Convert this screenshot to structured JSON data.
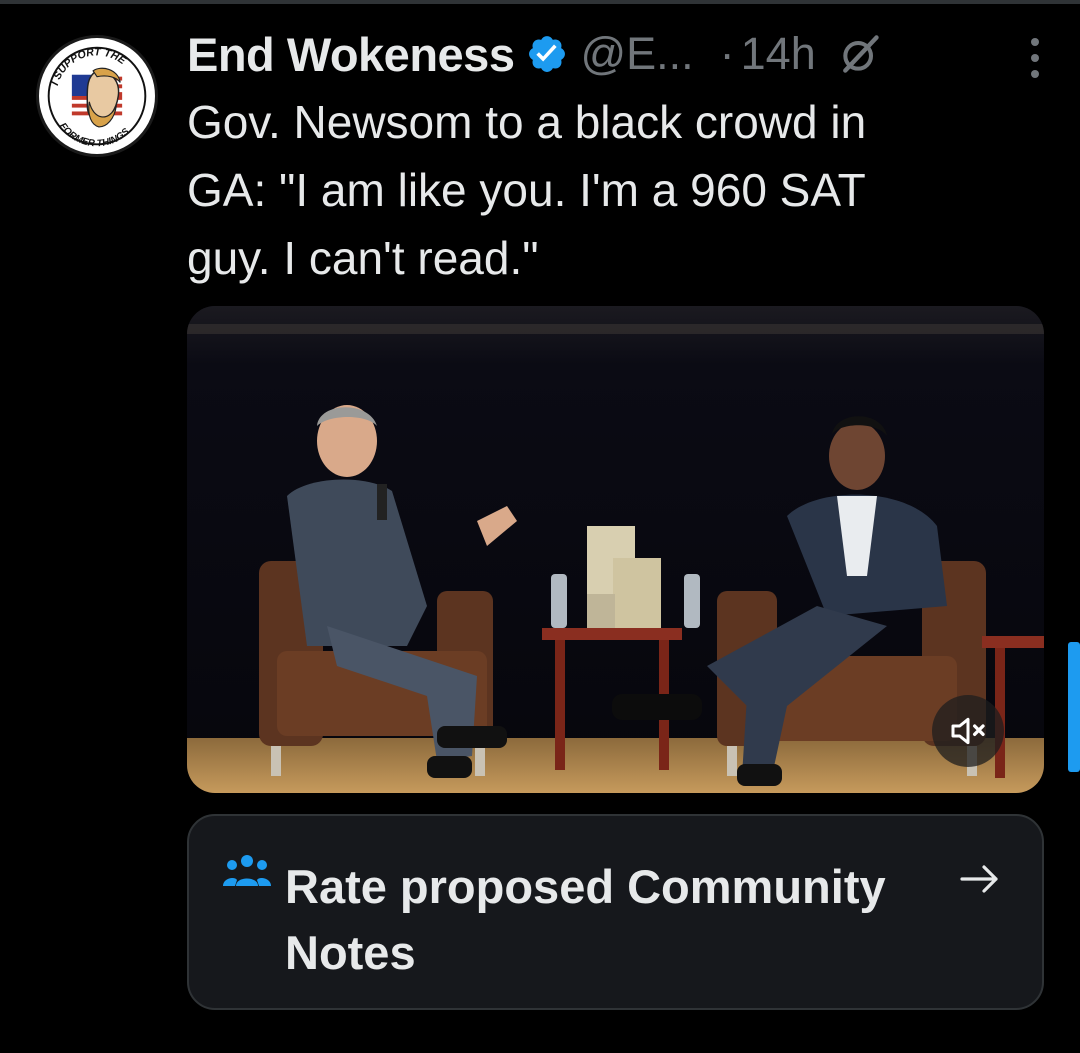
{
  "author": {
    "name": "End Wokeness",
    "handle": "@E...",
    "separator": "·",
    "time": "14h",
    "verified": true,
    "avatar_icon": "i-support-the-former-things-badge",
    "avatar_text_top": "I SUPPORT THE",
    "avatar_text_bottom": "FORMER THINGS"
  },
  "tweet": {
    "lines": [
      "Gov. Newsom to a black crowd in",
      "GA: \"I am like you. I'm a 960 SAT",
      "guy. I can't read.\""
    ]
  },
  "media": {
    "type": "video",
    "mute_icon": "speaker-muted-icon"
  },
  "community_notes": {
    "label": "Rate proposed Community Notes",
    "icon": "people-icon",
    "arrow": "→"
  },
  "colors": {
    "background": "#000000",
    "text": "#e7e9ea",
    "secondary": "#71767b",
    "accent": "#1d9bf0",
    "card": "#16181c",
    "border": "#2f3336"
  }
}
